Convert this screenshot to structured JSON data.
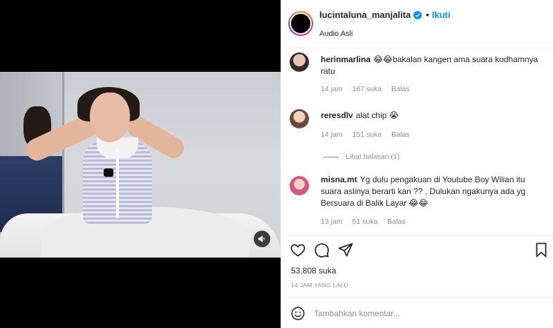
{
  "post": {
    "username": "lucintaluna_manjalita",
    "follow_separator": "•",
    "follow_label": "Ikuti",
    "audio_label": "Audio Asli",
    "likes": "53,808 suka",
    "posted_time": "14 JAM YANG LALU"
  },
  "comments": [
    {
      "username": "herinmarlina",
      "text": "😂😂bakalan kangen ama suara kodhamnya ratu",
      "time": "14 jam",
      "likes": "167 suka",
      "reply_label": "Balas"
    },
    {
      "username": "reresdlv",
      "text": "alat chip 😭",
      "time": "14 jam",
      "likes": "151 suka",
      "reply_label": "Balas"
    },
    {
      "username": "misna.mt",
      "text": "Yg dulu pengakuan di Youtube Boy Wilian itu suara aslinya berarti kan ?? , Dulukan ngakunya ada yg Bersuara di Balik Layar 😂😂",
      "time": "13 jam",
      "likes": "51 suka",
      "reply_label": "Balas"
    }
  ],
  "view_replies_label": "Lihat balasan (1)",
  "add_comment": {
    "placeholder": "Tambahkan komentar..."
  },
  "icons": {
    "like": "heart-icon",
    "comment": "comment-icon",
    "share": "share-icon",
    "save": "bookmark-icon",
    "emoji": "emoji-icon",
    "sound": "speaker-icon",
    "verified": "verified-badge-icon"
  },
  "colors": {
    "accent": "#0095f6",
    "meta": "#8e8e8e"
  }
}
